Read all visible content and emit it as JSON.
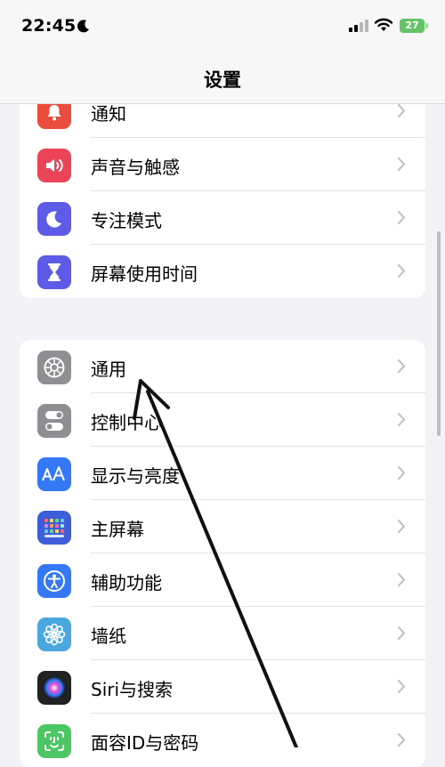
{
  "status_bar": {
    "time": "22:45",
    "battery": "27",
    "icons": [
      "moon-icon",
      "signal-icon",
      "wifi-icon",
      "battery-icon"
    ]
  },
  "nav": {
    "title": "设置"
  },
  "groups": [
    {
      "items": [
        {
          "label": "通知",
          "icon": "bell-icon",
          "color": "#eb4d3d"
        },
        {
          "label": "声音与触感",
          "icon": "speaker-icon",
          "color": "#eb4459"
        },
        {
          "label": "专注模式",
          "icon": "moon-icon",
          "color": "#5e5ce6"
        },
        {
          "label": "屏幕使用时间",
          "icon": "hourglass-icon",
          "color": "#5e5ce6"
        }
      ]
    },
    {
      "items": [
        {
          "label": "通用",
          "icon": "gear-icon",
          "color": "#8e8e93"
        },
        {
          "label": "控制中心",
          "icon": "toggle-icon",
          "color": "#8e8e93"
        },
        {
          "label": "显示与亮度",
          "icon": "text-size-icon",
          "color": "#3478f6"
        },
        {
          "label": "主屏幕",
          "icon": "home-grid-icon",
          "color": "#3d5ed8"
        },
        {
          "label": "辅助功能",
          "icon": "accessibility-icon",
          "color": "#3478f6"
        },
        {
          "label": "墙纸",
          "icon": "flower-icon",
          "color": "#4aa8de"
        },
        {
          "label": "Siri与搜索",
          "icon": "siri-icon",
          "color": "#222222"
        },
        {
          "label": "面容ID与密码",
          "icon": "faceid-icon",
          "color": "#4cc764"
        }
      ]
    }
  ],
  "colors": {
    "background": "#f2f2f7",
    "separator": "#e3e3e6",
    "chevron": "#c4c4c7"
  }
}
